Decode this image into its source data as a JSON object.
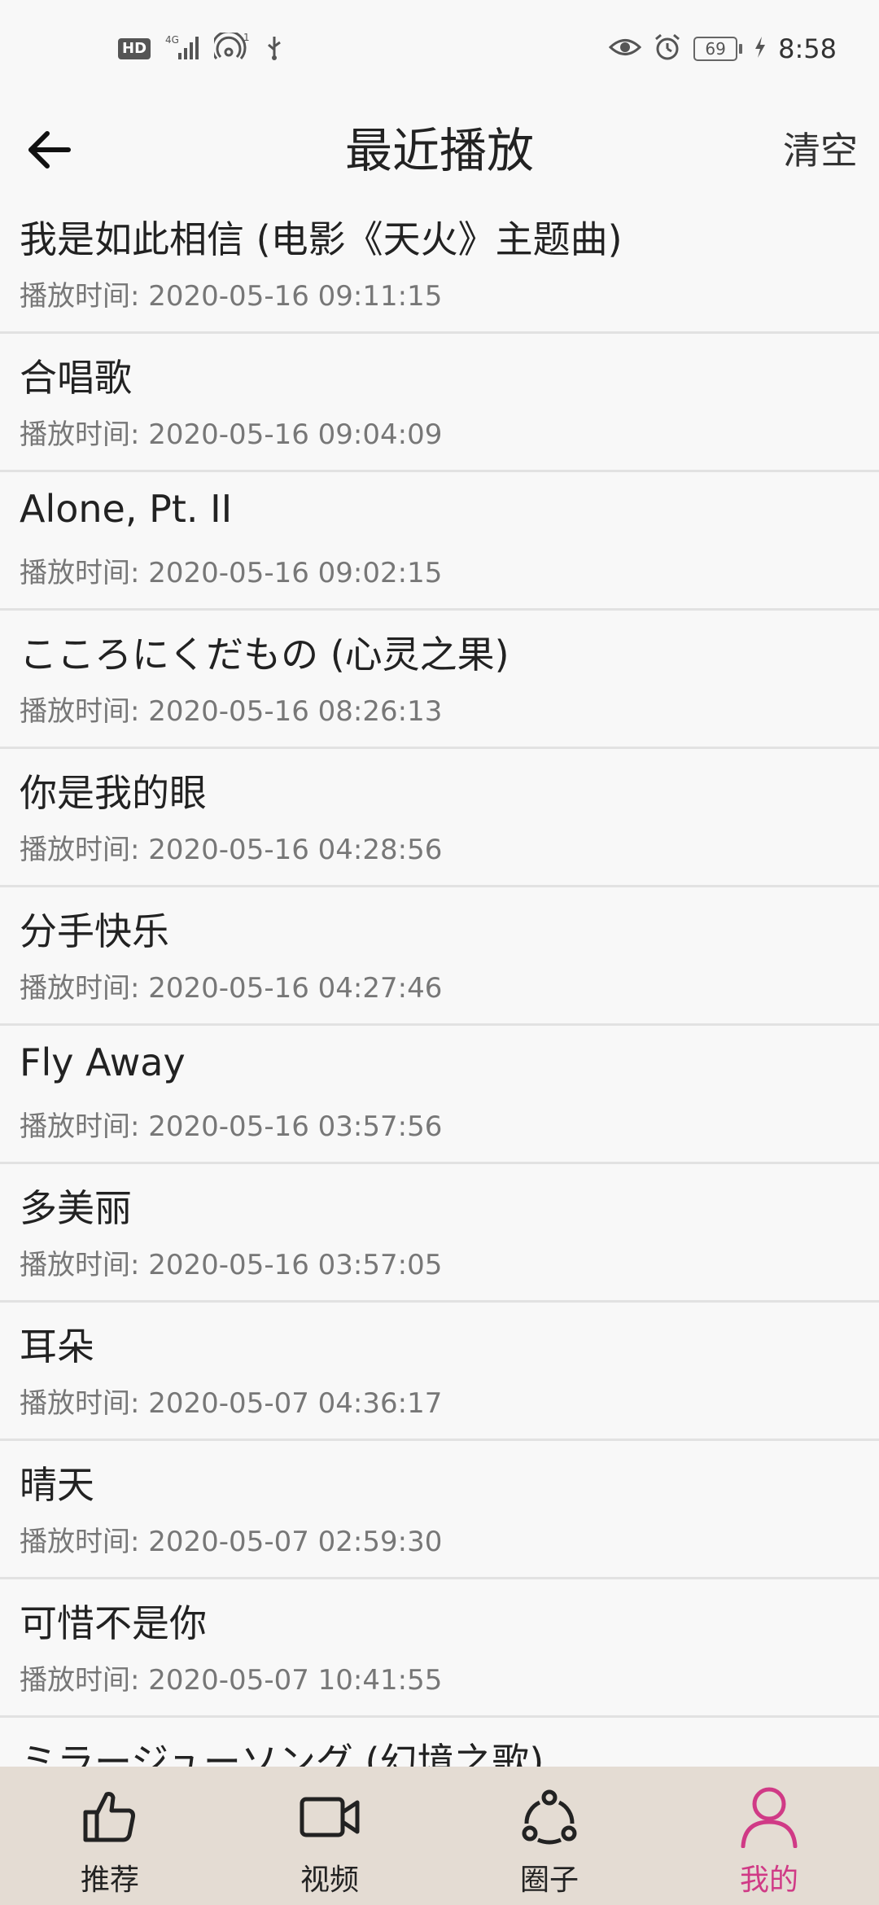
{
  "status_bar": {
    "hd": "HD",
    "network": "4G",
    "hotspot_count": "1",
    "battery": "69",
    "time": "8:58",
    "icons": [
      "hd-icon",
      "signal-icon",
      "hotspot-icon",
      "usb-icon",
      "eye-icon",
      "alarm-icon",
      "battery-icon",
      "charging-icon"
    ]
  },
  "header": {
    "title": "最近播放",
    "clear_label": "清空",
    "back_icon": "arrow-left-icon"
  },
  "items": [
    {
      "title": "我是如此相信 (电影《天火》主题曲)",
      "time": "播放时间: 2020-05-16 09:11:15"
    },
    {
      "title": "合唱歌",
      "time": "播放时间: 2020-05-16 09:04:09"
    },
    {
      "title": "Alone, Pt. II",
      "time": "播放时间: 2020-05-16 09:02:15"
    },
    {
      "title": "こころにくだもの (心灵之果)",
      "time": "播放时间: 2020-05-16 08:26:13"
    },
    {
      "title": "你是我的眼",
      "time": "播放时间: 2020-05-16 04:28:56"
    },
    {
      "title": "分手快乐",
      "time": "播放时间: 2020-05-16 04:27:46"
    },
    {
      "title": "Fly Away",
      "time": "播放时间: 2020-05-16 03:57:56"
    },
    {
      "title": "多美丽",
      "time": "播放时间: 2020-05-16 03:57:05"
    },
    {
      "title": "耳朵",
      "time": "播放时间: 2020-05-07 04:36:17"
    },
    {
      "title": "晴天",
      "time": "播放时间: 2020-05-07 02:59:30"
    },
    {
      "title": "可惜不是你",
      "time": "播放时间: 2020-05-07 10:41:55"
    },
    {
      "title": "ミラージューソング (幻境之歌)",
      "time": ""
    }
  ],
  "tabs": [
    {
      "label": "推荐",
      "icon": "thumbs-up-icon",
      "active": false
    },
    {
      "label": "视频",
      "icon": "video-camera-icon",
      "active": false
    },
    {
      "label": "圈子",
      "icon": "share-circle-icon",
      "active": false
    },
    {
      "label": "我的",
      "icon": "person-icon",
      "active": true
    }
  ],
  "colors": {
    "accent": "#d03a86",
    "tab_bar_bg": "#e4dcd3",
    "background": "#f8f8f8"
  }
}
